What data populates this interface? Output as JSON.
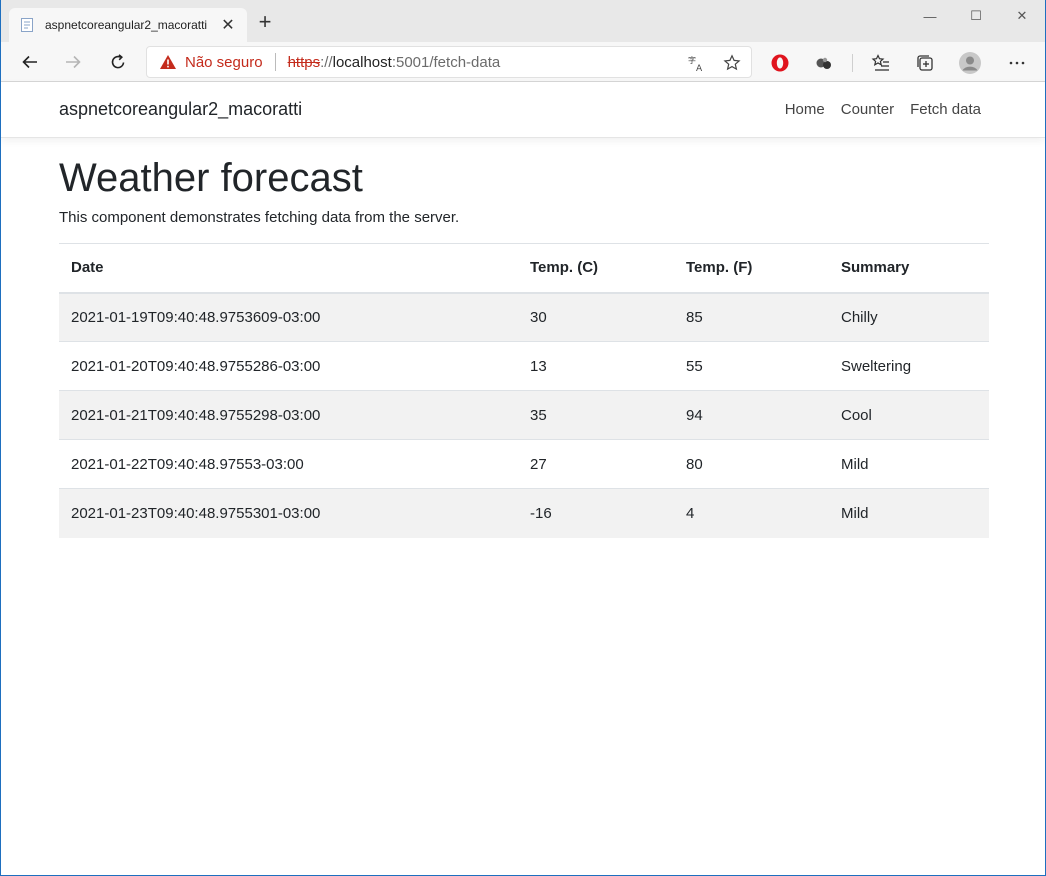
{
  "browser": {
    "tab_title": "aspnetcoreangular2_macoratti",
    "tab_close": "✕",
    "new_tab": "+",
    "window_controls": {
      "minimize": "—",
      "maximize": "☐",
      "close": "✕"
    },
    "security_label": "Não seguro",
    "url_scheme": "https",
    "url_sep": "://",
    "url_host": "localhost",
    "url_rest": ":5001/fetch-data",
    "icons": [
      "back-icon",
      "forward-icon",
      "refresh-icon",
      "warning-icon",
      "translate-icon",
      "star-icon",
      "opera-icon",
      "extension-icon",
      "favorites-icon",
      "collections-icon",
      "profile-icon",
      "more-icon"
    ],
    "colors": {
      "warning": "#c42b1c",
      "frame": "#1e6fbf"
    }
  },
  "app": {
    "brand": "aspnetcoreangular2_macoratti",
    "nav": [
      "Home",
      "Counter",
      "Fetch data"
    ]
  },
  "main": {
    "title": "Weather forecast",
    "description": "This component demonstrates fetching data from the server.",
    "table": {
      "headers": [
        "Date",
        "Temp. (C)",
        "Temp. (F)",
        "Summary"
      ],
      "rows": [
        [
          "2021-01-19T09:40:48.9753609-03:00",
          "30",
          "85",
          "Chilly"
        ],
        [
          "2021-01-20T09:40:48.9755286-03:00",
          "13",
          "55",
          "Sweltering"
        ],
        [
          "2021-01-21T09:40:48.9755298-03:00",
          "35",
          "94",
          "Cool"
        ],
        [
          "2021-01-22T09:40:48.97553-03:00",
          "27",
          "80",
          "Mild"
        ],
        [
          "2021-01-23T09:40:48.9755301-03:00",
          "-16",
          "4",
          "Mild"
        ]
      ]
    }
  }
}
